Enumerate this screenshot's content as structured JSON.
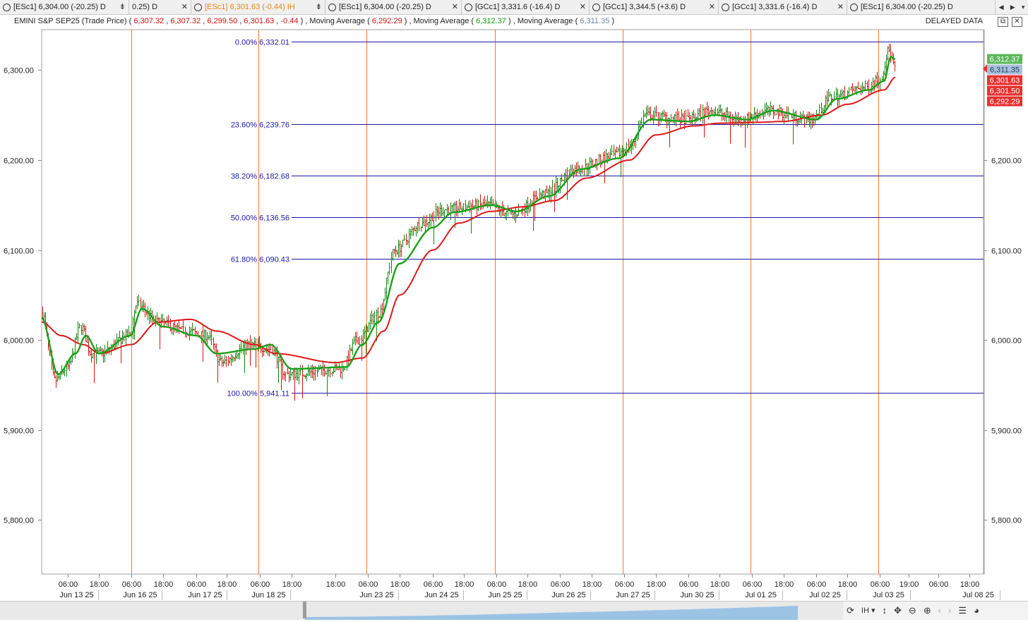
{
  "tabs": [
    {
      "label": "[ESc1] 6,304.00 (-20.25) D",
      "active": false,
      "btn": "⇟"
    },
    {
      "label": "0.25) D",
      "active": false,
      "btn": "✕"
    },
    {
      "label": "[ESc1] 6,301.63 (-0.44) IH",
      "active": true,
      "btn": "⇟"
    },
    {
      "label": "[ESc1] 6,304.00 (-20.25) D",
      "active": false,
      "btn": "✕"
    },
    {
      "label": "[GCc1] 3,331.6 (-16.4) D",
      "active": false,
      "btn": "✕"
    },
    {
      "label": "[GCc1] 3,344.5 (+3.6) D",
      "active": false,
      "btn": "✕"
    },
    {
      "label": "[GCc1] 3,331.6 (-16.4) D",
      "active": false,
      "btn": "✕"
    },
    {
      "label": "[ESc1] 6,304.00 (-20.25) D",
      "active": false,
      "btn": ""
    }
  ],
  "legend": {
    "instrument": "EMINI S&P SEP25 (Trade Price)",
    "ohlc_open": "6,307.32",
    "ohlc_high": "6,307.32",
    "ohlc_low": "6,299.50",
    "ohlc_close": "6,301.63",
    "ohlc_change": "-0.44",
    "ma1_label": "Moving Average",
    "ma1_value": "6,292.29",
    "ma2_label": "Moving Average",
    "ma2_value": "6,312.37",
    "ma3_label": "Moving Average",
    "ma3_value": "6,311.35"
  },
  "status": {
    "delayed": "DELAYED DATA"
  },
  "colors": {
    "up": "#0f8a0f",
    "down": "#d41414",
    "ma_fast": "#1aa01a",
    "ma_slow": "#e01818",
    "fib": "#1a1aa8",
    "session": "#f07a3c",
    "price_tag_green": "#5cb85c",
    "price_tag_blue": "#a8c0dc",
    "price_tag_red": "#e83030"
  },
  "toolbar": {
    "refresh": "refresh-icon",
    "interval": "IH",
    "interval_caret": "▾"
  },
  "chart_data": {
    "type": "candlestick",
    "instrument": "EMINI S&P SEP25",
    "y_range": [
      5740,
      6345
    ],
    "x_range": [
      "Jun 12 2025 22:00",
      "Jul 08 2025 22:00"
    ],
    "y_ticks": [
      {
        "value": 5800,
        "label": "5,800.00"
      },
      {
        "value": 5900,
        "label": "5,900.00"
      },
      {
        "value": 6000,
        "label": "6,000.00"
      },
      {
        "value": 6100,
        "label": "6,100.00"
      },
      {
        "value": 6200,
        "label": "6,200.00"
      },
      {
        "value": 6300,
        "label": "6,300.00"
      }
    ],
    "x_ticks": [
      {
        "t": "Jun 13 2025 06:00",
        "time": "06:00",
        "date": "Jun 13 25"
      },
      {
        "t": "Jun 13 2025 18:00",
        "time": "18:00",
        "date": ""
      },
      {
        "t": "Jun 16 2025 06:00",
        "time": "06:00",
        "date": "Jun 16 25"
      },
      {
        "t": "Jun 16 2025 18:00",
        "time": "18:00",
        "date": ""
      },
      {
        "t": "Jun 17 2025 06:00",
        "time": "06:00",
        "date": "Jun 17 25"
      },
      {
        "t": "Jun 17 2025 18:00",
        "time": "18:00",
        "date": ""
      },
      {
        "t": "Jun 18 2025 06:00",
        "time": "06:00",
        "date": "Jun 18 25"
      },
      {
        "t": "Jun 18 2025 18:00",
        "time": "18:00",
        "date": ""
      },
      {
        "t": "Jun 22 2025 18:00",
        "time": "18:00",
        "date": ""
      },
      {
        "t": "Jun 23 2025 06:00",
        "time": "06:00",
        "date": "Jun 23 25"
      },
      {
        "t": "Jun 23 2025 18:00",
        "time": "18:00",
        "date": ""
      },
      {
        "t": "Jun 24 2025 06:00",
        "time": "06:00",
        "date": "Jun 24 25"
      },
      {
        "t": "Jun 24 2025 18:00",
        "time": "18:00",
        "date": ""
      },
      {
        "t": "Jun 25 2025 06:00",
        "time": "06:00",
        "date": "Jun 25 25"
      },
      {
        "t": "Jun 25 2025 18:00",
        "time": "18:00",
        "date": ""
      },
      {
        "t": "Jun 26 2025 06:00",
        "time": "06:00",
        "date": "Jun 26 25"
      },
      {
        "t": "Jun 26 2025 18:00",
        "time": "18:00",
        "date": ""
      },
      {
        "t": "Jun 27 2025 06:00",
        "time": "06:00",
        "date": "Jun 27 25"
      },
      {
        "t": "Jun 27 2025 18:00",
        "time": "18:00",
        "date": ""
      },
      {
        "t": "Jun 30 2025 06:00",
        "time": "06:00",
        "date": "Jun 30 25"
      },
      {
        "t": "Jun 30 2025 18:00",
        "time": "18:00",
        "date": ""
      },
      {
        "t": "Jul 01 2025 06:00",
        "time": "06:00",
        "date": "Jul 01 25"
      },
      {
        "t": "Jul 01 2025 18:00",
        "time": "18:00",
        "date": ""
      },
      {
        "t": "Jul 02 2025 06:00",
        "time": "06:00",
        "date": "Jul 02 25"
      },
      {
        "t": "Jul 02 2025 18:00",
        "time": "18:00",
        "date": ""
      },
      {
        "t": "Jul 03 2025 06:00",
        "time": "06:00",
        "date": "Jul 03 25"
      },
      {
        "t": "Jul 03 2025 19:00",
        "time": "19:00",
        "date": ""
      },
      {
        "t": "Jul 07 2025 06:00",
        "time": "06:00",
        "date": ""
      },
      {
        "t": "Jul 07 2025 18:00",
        "time": "18:00",
        "date": "Jul 08 25"
      }
    ],
    "session_breaks": [
      "Jun 16 2025 05:30",
      "Jun 18 2025 05:30",
      "Jun 23 2025 05:30",
      "Jun 25 2025 05:30",
      "Jun 27 2025 05:30",
      "Jul 01 2025 05:30",
      "Jul 03 2025 05:30"
    ],
    "fib_anchor_start": "Jun 18 2025 18:00",
    "fibonacci": [
      {
        "level": "0.00%",
        "price": 6332.01,
        "label": "0.00% 6,332.01"
      },
      {
        "level": "23.60%",
        "price": 6239.76,
        "label": "23.60% 6,239.76"
      },
      {
        "level": "38.20%",
        "price": 6182.68,
        "label": "38.20% 6,182.68"
      },
      {
        "level": "50.00%",
        "price": 6136.56,
        "label": "50.00% 6,136.56"
      },
      {
        "level": "61.80%",
        "price": 6090.43,
        "label": "61.80% 6,090.43"
      },
      {
        "level": "100.00%",
        "price": 5941.11,
        "label": "100.00% 5,941.11"
      }
    ],
    "price_path": [
      {
        "t": "Jun 12 2025 22:00",
        "v": 6030
      },
      {
        "t": "Jun 13 2025 02:00",
        "v": 5955
      },
      {
        "t": "Jun 13 2025 06:00",
        "v": 5970
      },
      {
        "t": "Jun 13 2025 11:00",
        "v": 6015
      },
      {
        "t": "Jun 13 2025 15:00",
        "v": 5985
      },
      {
        "t": "Jun 13 2025 20:00",
        "v": 5985
      },
      {
        "t": "Jun 16 2025 02:00",
        "v": 6005
      },
      {
        "t": "Jun 16 2025 08:00",
        "v": 6040
      },
      {
        "t": "Jun 16 2025 16:00",
        "v": 6020
      },
      {
        "t": "Jun 17 2025 02:00",
        "v": 6010
      },
      {
        "t": "Jun 17 2025 10:00",
        "v": 6005
      },
      {
        "t": "Jun 17 2025 16:00",
        "v": 5975
      },
      {
        "t": "Jun 18 2025 02:00",
        "v": 5995
      },
      {
        "t": "Jun 18 2025 10:00",
        "v": 5990
      },
      {
        "t": "Jun 18 2025 16:00",
        "v": 5962
      },
      {
        "t": "Jun 22 2025 20:00",
        "v": 5968
      },
      {
        "t": "Jun 23 2025 02:00",
        "v": 6000
      },
      {
        "t": "Jun 23 2025 10:00",
        "v": 6030
      },
      {
        "t": "Jun 23 2025 16:00",
        "v": 6100
      },
      {
        "t": "Jun 24 2025 02:00",
        "v": 6130
      },
      {
        "t": "Jun 24 2025 10:00",
        "v": 6145
      },
      {
        "t": "Jun 25 2025 02:00",
        "v": 6150
      },
      {
        "t": "Jun 25 2025 12:00",
        "v": 6140
      },
      {
        "t": "Jun 26 2025 00:00",
        "v": 6162
      },
      {
        "t": "Jun 26 2025 12:00",
        "v": 6190
      },
      {
        "t": "Jun 27 2025 02:00",
        "v": 6205
      },
      {
        "t": "Jun 27 2025 08:00",
        "v": 6215
      },
      {
        "t": "Jun 27 2025 14:00",
        "v": 6250
      },
      {
        "t": "Jun 30 2025 04:00",
        "v": 6245
      },
      {
        "t": "Jun 30 2025 14:00",
        "v": 6255
      },
      {
        "t": "Jul 01 2025 02:00",
        "v": 6245
      },
      {
        "t": "Jul 01 2025 12:00",
        "v": 6255
      },
      {
        "t": "Jul 02 2025 04:00",
        "v": 6245
      },
      {
        "t": "Jul 02 2025 12:00",
        "v": 6270
      },
      {
        "t": "Jul 03 2025 00:00",
        "v": 6280
      },
      {
        "t": "Jul 03 2025 06:00",
        "v": 6290
      },
      {
        "t": "Jul 03 2025 10:00",
        "v": 6322
      },
      {
        "t": "Jul 03 2025 13:00",
        "v": 6302
      }
    ],
    "ma_fast": [
      {
        "t": "Jun 12 2025 22:00",
        "v": 6025
      },
      {
        "t": "Jun 13 2025 03:00",
        "v": 5962
      },
      {
        "t": "Jun 13 2025 09:00",
        "v": 5985
      },
      {
        "t": "Jun 13 2025 13:00",
        "v": 6005
      },
      {
        "t": "Jun 13 2025 18:00",
        "v": 5985
      },
      {
        "t": "Jun 16 2025 04:00",
        "v": 6005
      },
      {
        "t": "Jun 16 2025 10:00",
        "v": 6035
      },
      {
        "t": "Jun 16 2025 18:00",
        "v": 6015
      },
      {
        "t": "Jun 17 2025 06:00",
        "v": 6005
      },
      {
        "t": "Jun 17 2025 14:00",
        "v": 5985
      },
      {
        "t": "Jun 18 2025 04:00",
        "v": 5990
      },
      {
        "t": "Jun 18 2025 10:00",
        "v": 5995
      },
      {
        "t": "Jun 18 2025 18:00",
        "v": 5968
      },
      {
        "t": "Jun 22 2025 22:00",
        "v": 5970
      },
      {
        "t": "Jun 23 2025 04:00",
        "v": 5995
      },
      {
        "t": "Jun 23 2025 10:00",
        "v": 6020
      },
      {
        "t": "Jun 23 2025 18:00",
        "v": 6085
      },
      {
        "t": "Jun 24 2025 06:00",
        "v": 6125
      },
      {
        "t": "Jun 24 2025 14:00",
        "v": 6142
      },
      {
        "t": "Jun 25 2025 04:00",
        "v": 6150
      },
      {
        "t": "Jun 25 2025 14:00",
        "v": 6143
      },
      {
        "t": "Jun 26 2025 02:00",
        "v": 6160
      },
      {
        "t": "Jun 26 2025 14:00",
        "v": 6190
      },
      {
        "t": "Jun 27 2025 04:00",
        "v": 6202
      },
      {
        "t": "Jun 27 2025 16:00",
        "v": 6245
      },
      {
        "t": "Jun 30 2025 06:00",
        "v": 6243
      },
      {
        "t": "Jun 30 2025 16:00",
        "v": 6250
      },
      {
        "t": "Jul 01 2025 04:00",
        "v": 6245
      },
      {
        "t": "Jul 01 2025 14:00",
        "v": 6255
      },
      {
        "t": "Jul 02 2025 06:00",
        "v": 6245
      },
      {
        "t": "Jul 02 2025 14:00",
        "v": 6268
      },
      {
        "t": "Jul 03 2025 02:00",
        "v": 6278
      },
      {
        "t": "Jul 03 2025 08:00",
        "v": 6288
      },
      {
        "t": "Jul 03 2025 11:00",
        "v": 6315
      },
      {
        "t": "Jul 03 2025 13:00",
        "v": 6312
      }
    ],
    "ma_slow": [
      {
        "t": "Jun 12 2025 22:00",
        "v": 6020
      },
      {
        "t": "Jun 13 2025 04:00",
        "v": 6005
      },
      {
        "t": "Jun 13 2025 12:00",
        "v": 5995
      },
      {
        "t": "Jun 13 2025 20:00",
        "v": 5985
      },
      {
        "t": "Jun 16 2025 06:00",
        "v": 5995
      },
      {
        "t": "Jun 16 2025 16:00",
        "v": 6020
      },
      {
        "t": "Jun 17 2025 04:00",
        "v": 6023
      },
      {
        "t": "Jun 17 2025 14:00",
        "v": 6010
      },
      {
        "t": "Jun 18 2025 04:00",
        "v": 5995
      },
      {
        "t": "Jun 18 2025 12:00",
        "v": 5985
      },
      {
        "t": "Jun 22 2025 18:00",
        "v": 5975
      },
      {
        "t": "Jun 23 2025 04:00",
        "v": 5980
      },
      {
        "t": "Jun 23 2025 12:00",
        "v": 6010
      },
      {
        "t": "Jun 23 2025 18:00",
        "v": 6050
      },
      {
        "t": "Jun 24 2025 06:00",
        "v": 6100
      },
      {
        "t": "Jun 24 2025 16:00",
        "v": 6130
      },
      {
        "t": "Jun 25 2025 04:00",
        "v": 6143
      },
      {
        "t": "Jun 25 2025 16:00",
        "v": 6148
      },
      {
        "t": "Jun 26 2025 04:00",
        "v": 6155
      },
      {
        "t": "Jun 26 2025 16:00",
        "v": 6180
      },
      {
        "t": "Jun 27 2025 08:00",
        "v": 6200
      },
      {
        "t": "Jun 27 2025 18:00",
        "v": 6228
      },
      {
        "t": "Jun 30 2025 08:00",
        "v": 6238
      },
      {
        "t": "Jun 30 2025 18:00",
        "v": 6241
      },
      {
        "t": "Jul 01 2025 08:00",
        "v": 6242
      },
      {
        "t": "Jul 01 2025 18:00",
        "v": 6243
      },
      {
        "t": "Jul 02 2025 08:00",
        "v": 6250
      },
      {
        "t": "Jul 02 2025 18:00",
        "v": 6262
      },
      {
        "t": "Jul 03 2025 08:00",
        "v": 6278
      },
      {
        "t": "Jul 03 2025 13:00",
        "v": 6292
      }
    ],
    "price_tags": [
      {
        "value": 6312.37,
        "label": "6,312.37",
        "style": "green"
      },
      {
        "value": 6311.35,
        "label": "6,311.35",
        "style": "blue"
      },
      {
        "value": 6301.63,
        "label": "6,301.63",
        "style": "red"
      },
      {
        "value": 6301.5,
        "label": "6,301.50",
        "style": "red"
      },
      {
        "value": 6292.29,
        "label": "6,292.29",
        "style": "red"
      }
    ]
  }
}
